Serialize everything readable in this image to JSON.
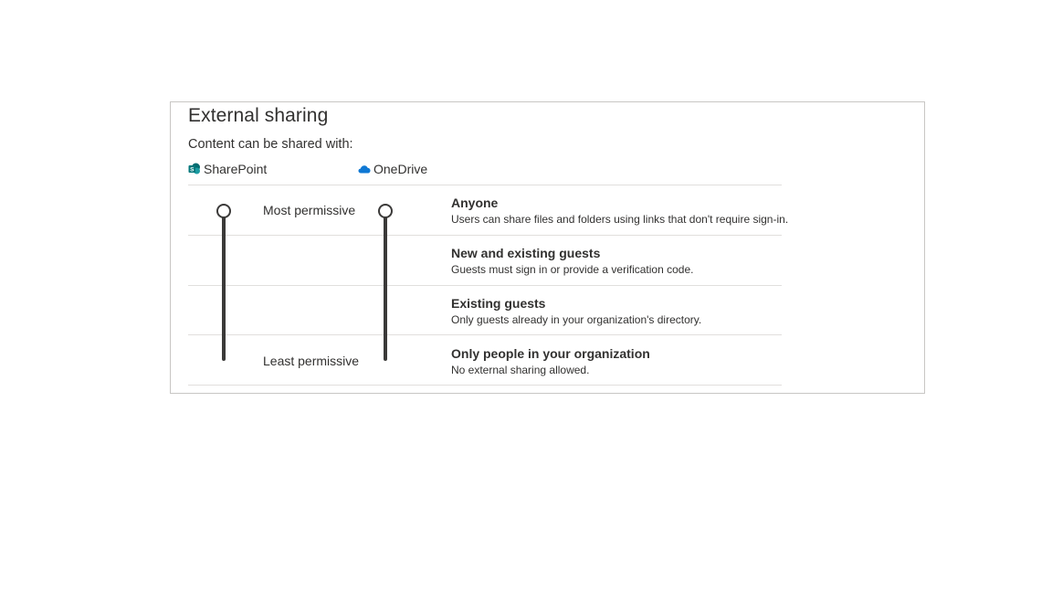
{
  "panel": {
    "title": "External sharing",
    "subtitle": "Content can be shared with:"
  },
  "services": [
    {
      "label": "SharePoint",
      "icon": "sharepoint-icon",
      "color": "#036C70"
    },
    {
      "label": "OneDrive",
      "icon": "onedrive-icon",
      "color": "#0364B8"
    }
  ],
  "slider_labels": {
    "top": "Most permissive",
    "bottom": "Least permissive"
  },
  "sliders": {
    "sharepoint_level": "Anyone",
    "onedrive_level": "Anyone"
  },
  "levels": [
    {
      "name": "Anyone",
      "description": "Users can share files and folders using links that don't require sign-in."
    },
    {
      "name": "New and existing guests",
      "description": "Guests must sign in or provide a verification code."
    },
    {
      "name": "Existing guests",
      "description": "Only guests already in your organization's directory."
    },
    {
      "name": "Only people in your organization",
      "description": "No external sharing allowed."
    }
  ],
  "colors": {
    "slider": "#3B3A39",
    "divider": "#E1DFDD",
    "panel_border": "#C8C6C4"
  }
}
